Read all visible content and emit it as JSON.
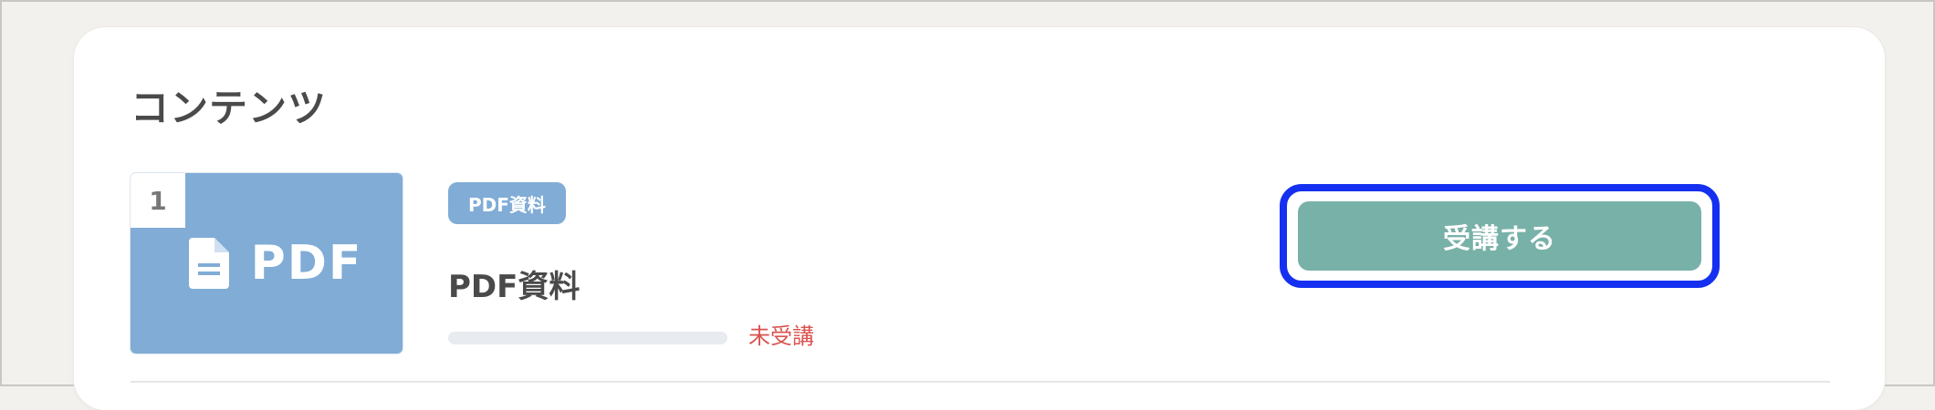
{
  "section": {
    "title": "コンテンツ"
  },
  "item": {
    "index": "1",
    "thumbnail_label": "PDF",
    "thumbnail_icon": "document-icon",
    "type_badge": "PDF資料",
    "title": "PDF資料",
    "progress_percent": 0,
    "status": "未受講",
    "action_label": "受講する"
  },
  "colors": {
    "thumbnail_bg": "#80acd6",
    "badge_bg": "#80acd6",
    "button_bg": "#78b1a8",
    "status_text": "#d9534f",
    "focus_ring": "#1530f0",
    "page_bg": "#f3f1ee"
  }
}
